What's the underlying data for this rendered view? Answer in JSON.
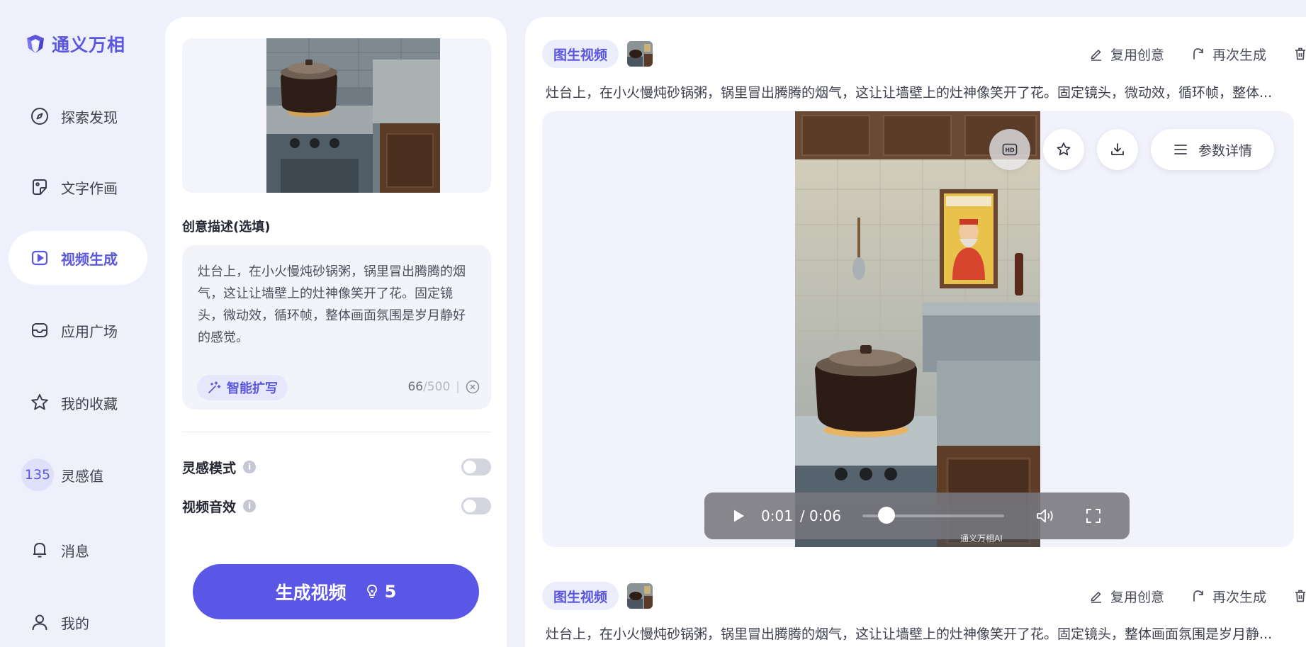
{
  "app": {
    "name": "通义万相",
    "brand_color": "#5b57df"
  },
  "sidebar": {
    "items": [
      {
        "label": "探索发现",
        "icon": "compass-icon"
      },
      {
        "label": "文字作画",
        "icon": "sticker-image-icon"
      },
      {
        "label": "视频生成",
        "icon": "video-play-icon",
        "active": true
      },
      {
        "label": "应用广场",
        "icon": "app-square-icon"
      },
      {
        "label": "我的收藏",
        "icon": "star-icon"
      },
      {
        "label": "灵感值",
        "icon": "points-badge",
        "badge": "135"
      },
      {
        "label": "消息",
        "icon": "bell-icon"
      },
      {
        "label": "我的",
        "icon": "user-icon"
      }
    ]
  },
  "left_panel": {
    "prompt_title": "创意描述(选填)",
    "prompt_text": "灶台上，在小火慢炖砂锅粥，锅里冒出腾腾的烟气，这让让墙壁上的灶神像笑开了花。固定镜头，微动效，循环帧，整体画面氛围是岁月静好的感觉。",
    "smart_expand_label": "智能扩写",
    "char_count": "66",
    "char_max": "/500",
    "options": [
      {
        "label": "灵感模式",
        "enabled": false
      },
      {
        "label": "视频音效",
        "enabled": false
      }
    ],
    "generate_label": "生成视频",
    "generate_cost": "5"
  },
  "results": [
    {
      "type_tag": "图生视频",
      "reuse_label": "复用创意",
      "regenerate_label": "再次生成",
      "description": "灶台上，在小火慢炖砂锅粥，锅里冒出腾腾的烟气，这让让墙壁上的灶神像笑开了花。固定镜头，微动效，循环帧，整体...",
      "video": {
        "current_time": "0:01",
        "duration": "/ 0:06",
        "progress": 0.17,
        "params_label": "参数详情",
        "watermark": "通义万相AI"
      }
    },
    {
      "type_tag": "图生视频",
      "reuse_label": "复用创意",
      "regenerate_label": "再次生成",
      "description": "灶台上，在小火慢炖砂锅粥，锅里冒出腾腾的烟气，这让让墙壁上的灶神像笑开了花。固定镜头，整体画面氛围是岁月静..."
    }
  ]
}
